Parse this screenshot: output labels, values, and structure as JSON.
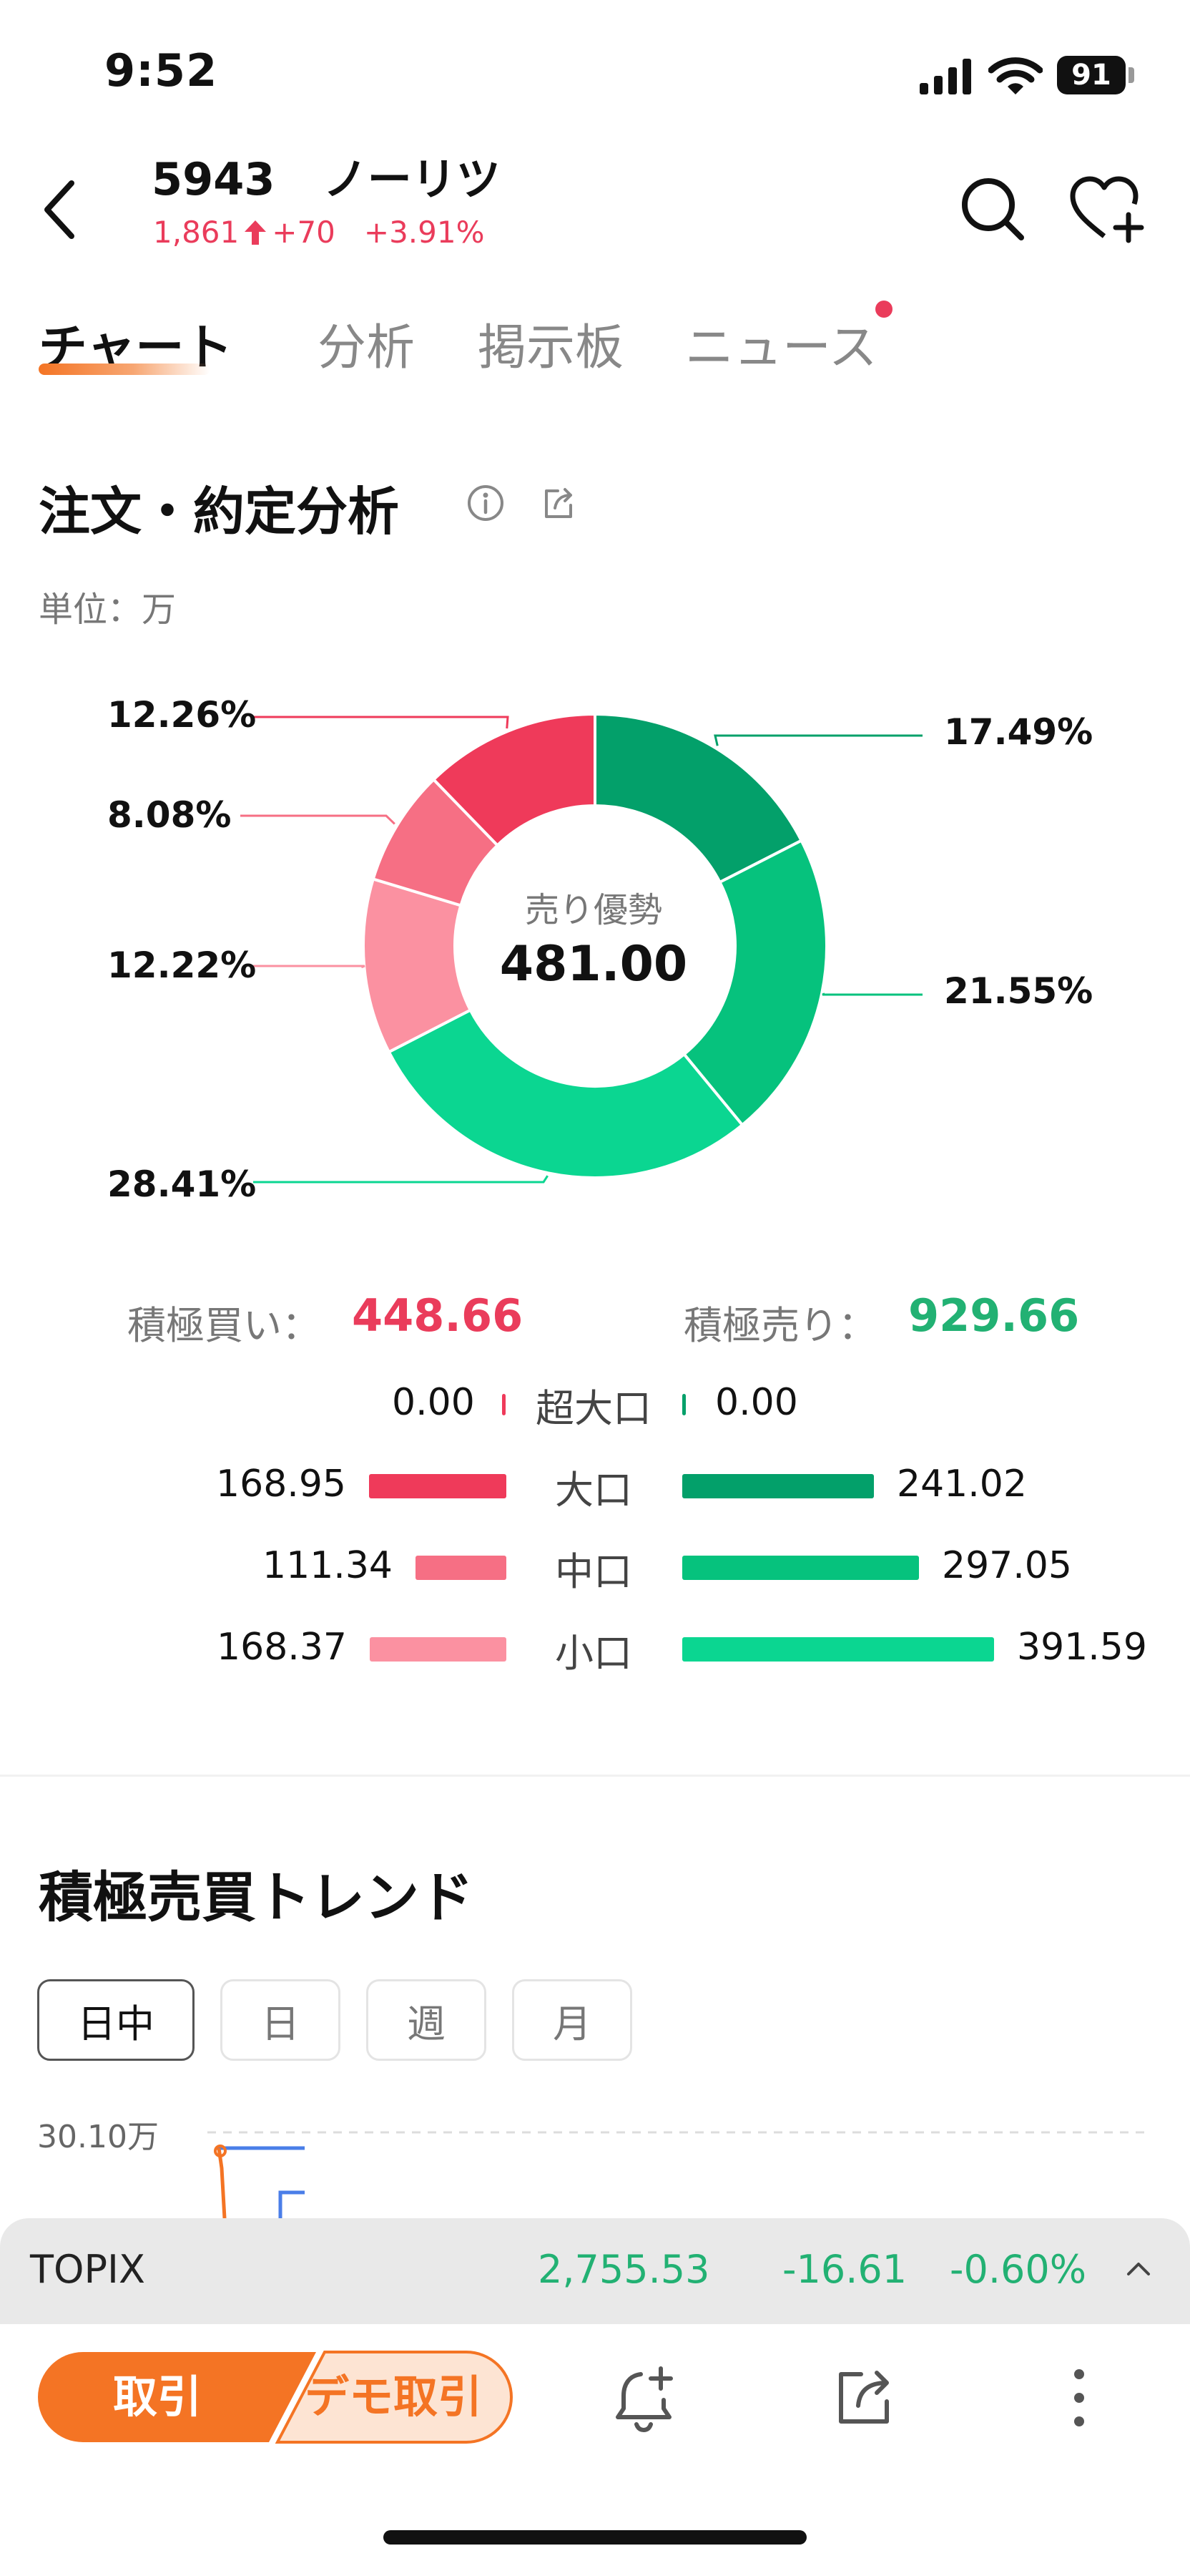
{
  "status_bar": {
    "time": "9:52",
    "battery": "91"
  },
  "header": {
    "code": "5943",
    "name": "ノーリツ",
    "price": "1,861",
    "change": "+70",
    "change_pct": "+3.91%"
  },
  "tabs": [
    {
      "label": "チャート",
      "active": true
    },
    {
      "label": "分析"
    },
    {
      "label": "掲示板"
    },
    {
      "label": "ニュース",
      "badge": true
    }
  ],
  "section": {
    "title": "注文・約定分析",
    "unit": "単位：万"
  },
  "chart_data": {
    "type": "pie",
    "center_label": "売り優勢",
    "center_value": "481.00",
    "slices": [
      {
        "label": "17.49%",
        "value": 17.49,
        "color": "#03a06a"
      },
      {
        "label": "21.55%",
        "value": 21.55,
        "color": "#06c27d"
      },
      {
        "label": "28.41%",
        "value": 28.41,
        "color": "#0bd691"
      },
      {
        "label": "12.22%",
        "value": 12.22,
        "color": "#fb91a1"
      },
      {
        "label": "8.08%",
        "value": 8.08,
        "color": "#f66f84"
      },
      {
        "label": "12.26%",
        "value": 12.26,
        "color": "#ef3a5a"
      }
    ]
  },
  "summary": {
    "buy_label": "積極買い：",
    "buy_value": "448.66",
    "sell_label": "積極売り：",
    "sell_value": "929.66"
  },
  "breakdown": {
    "buy_scale": 168.95,
    "sell_scale": 391.59,
    "rows": [
      {
        "label": "超大口",
        "buy": "0.00",
        "sell": "0.00",
        "buy_value": 0,
        "sell_value": 0,
        "buy_color": "#ef3a5a",
        "sell_color": "#03a06a"
      },
      {
        "label": "大口",
        "buy": "168.95",
        "sell": "241.02",
        "buy_value": 168.95,
        "sell_value": 241.02,
        "buy_color": "#ef3a5a",
        "sell_color": "#03a06a"
      },
      {
        "label": "中口",
        "buy": "111.34",
        "sell": "297.05",
        "buy_value": 111.34,
        "sell_value": 297.05,
        "buy_color": "#f66f84",
        "sell_color": "#06c27d"
      },
      {
        "label": "小口",
        "buy": "168.37",
        "sell": "391.59",
        "buy_value": 168.37,
        "sell_value": 391.59,
        "buy_color": "#fb91a1",
        "sell_color": "#0bd691"
      }
    ]
  },
  "trend": {
    "title": "積極売買トレンド",
    "periods": [
      "日中",
      "日",
      "週",
      "月"
    ],
    "y_label": "30.10万"
  },
  "index_bar": {
    "name": "TOPIX",
    "value": "2,755.53",
    "change": "-16.61",
    "change_pct": "-0.60%"
  },
  "toolbar": {
    "trade": "取引",
    "demo_trade": "デモ取引"
  },
  "colors": {
    "up": "#ea3c5b",
    "down": "#22b173",
    "accent": "#f47424"
  }
}
